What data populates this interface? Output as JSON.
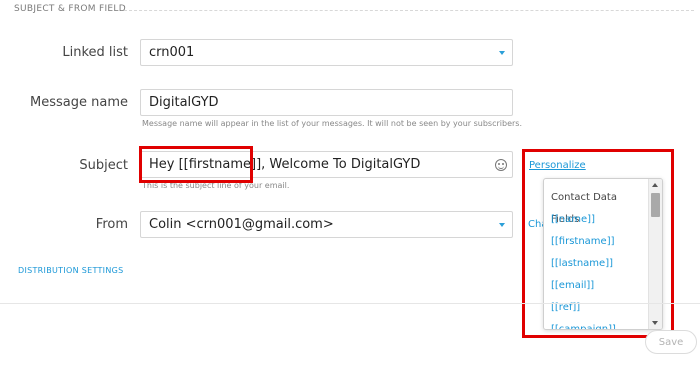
{
  "section": {
    "title": "SUBJECT & FROM FIELD"
  },
  "linked_list": {
    "label": "Linked list",
    "value": "crn001"
  },
  "message_name": {
    "label": "Message name",
    "value": "DigitalGYD",
    "hint": "Message name will appear in the list of your messages. It will not be seen by your subscribers."
  },
  "subject": {
    "label": "Subject",
    "value": "Hey [[firstname]], Welcome To DigitalGYD",
    "hint": "This is the subject line of your email.",
    "personalize_link": "Personalize"
  },
  "from": {
    "label": "From",
    "value": "Colin <crn001@gmail.com>",
    "change_link": "Cha"
  },
  "distribution": {
    "label": "DISTRIBUTION SETTINGS"
  },
  "save_label": "Save",
  "personalize_menu": {
    "header": "Contact Data Fields",
    "items": [
      "[[name]]",
      "[[firstname]]",
      "[[lastname]]",
      "[[email]]",
      "[[ref]]",
      "[[campaign]]"
    ]
  },
  "colors": {
    "accent": "#1a97d7",
    "highlight": "#e00000"
  },
  "icons": {
    "select_caret": "chevron-down-icon",
    "emoji": "smiley-icon"
  }
}
